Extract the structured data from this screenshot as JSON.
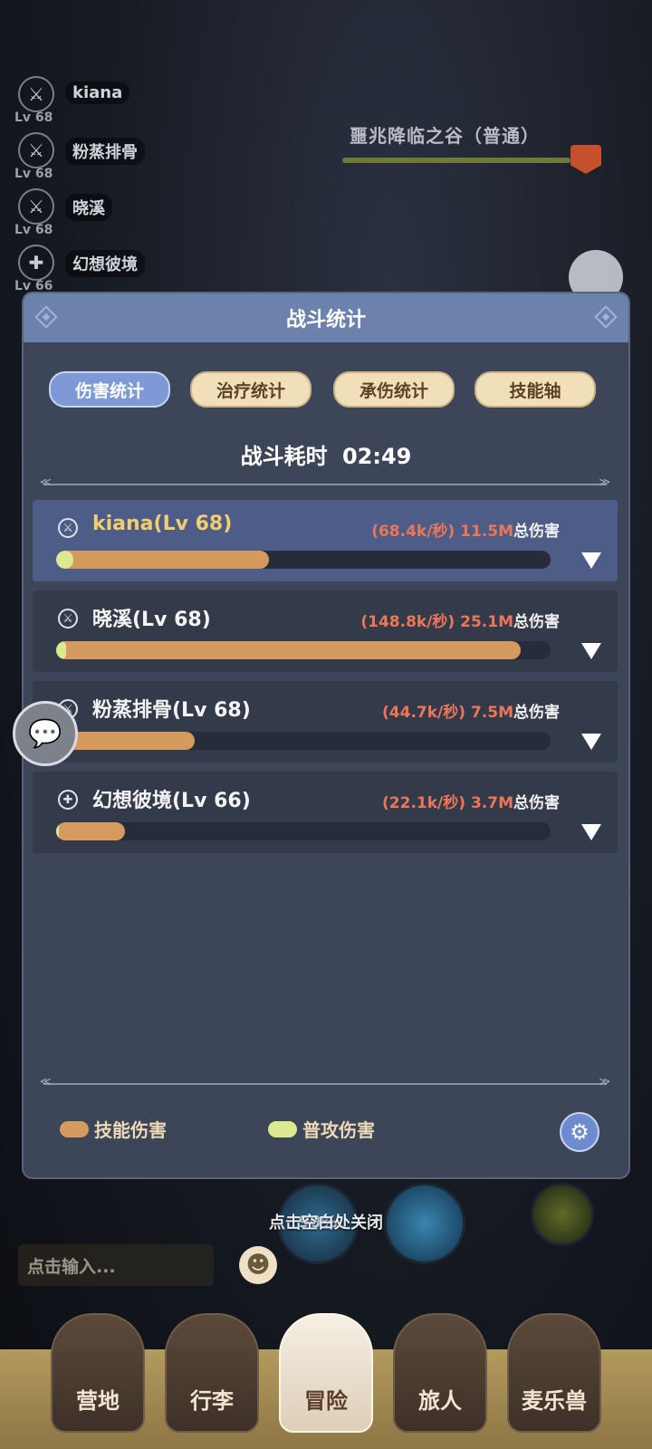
{
  "background": {
    "party": [
      {
        "name": "kiana",
        "level": "Lv 68",
        "icon": "crossed-swords-icon"
      },
      {
        "name": "粉蒸排骨",
        "level": "Lv 68",
        "icon": "crossed-swords-icon"
      },
      {
        "name": "晓溪",
        "level": "Lv 68",
        "icon": "crossed-swords-icon"
      },
      {
        "name": "幻想彼境",
        "level": "Lv 66",
        "icon": "cross-shield-icon"
      }
    ],
    "stage_title": "噩兆降临之谷（普通）",
    "close_hint": "点击空白处关闭",
    "chat_placeholder": "点击输入...",
    "orb_percent": "90%",
    "nav": [
      "营地",
      "行李",
      "冒险",
      "旅人",
      "麦乐兽"
    ],
    "active_nav": "冒险"
  },
  "dialog": {
    "title": "战斗统计",
    "tabs": [
      "伤害统计",
      "治疗统计",
      "承伤统计",
      "技能轴"
    ],
    "active_tab": "伤害统计",
    "duration_label": "战斗耗时",
    "duration_value": "02:49",
    "rows": [
      {
        "name": "kiana(Lv 68)",
        "dps": "(68.4k/秒)",
        "total": "11.5M",
        "total_label": "总伤害",
        "skill_fraction": 0.43,
        "normal_fraction": 0.035,
        "highlight": true
      },
      {
        "name": "晓溪(Lv 68)",
        "dps": "(148.8k/秒)",
        "total": "25.1M",
        "total_label": "总伤害",
        "skill_fraction": 0.94,
        "normal_fraction": 0.02,
        "highlight": false
      },
      {
        "name": "粉蒸排骨(Lv 68)",
        "dps": "(44.7k/秒)",
        "total": "7.5M",
        "total_label": "总伤害",
        "skill_fraction": 0.28,
        "normal_fraction": 0.015,
        "highlight": false
      },
      {
        "name": "幻想彼境(Lv 66)",
        "dps": "(22.1k/秒)",
        "total": "3.7M",
        "total_label": "总伤害",
        "skill_fraction": 0.14,
        "normal_fraction": 0.005,
        "highlight": false
      }
    ],
    "legend": [
      {
        "label": "技能伤害",
        "color": "#d59b5e"
      },
      {
        "label": "普攻伤害",
        "color": "#dde98f"
      }
    ]
  }
}
